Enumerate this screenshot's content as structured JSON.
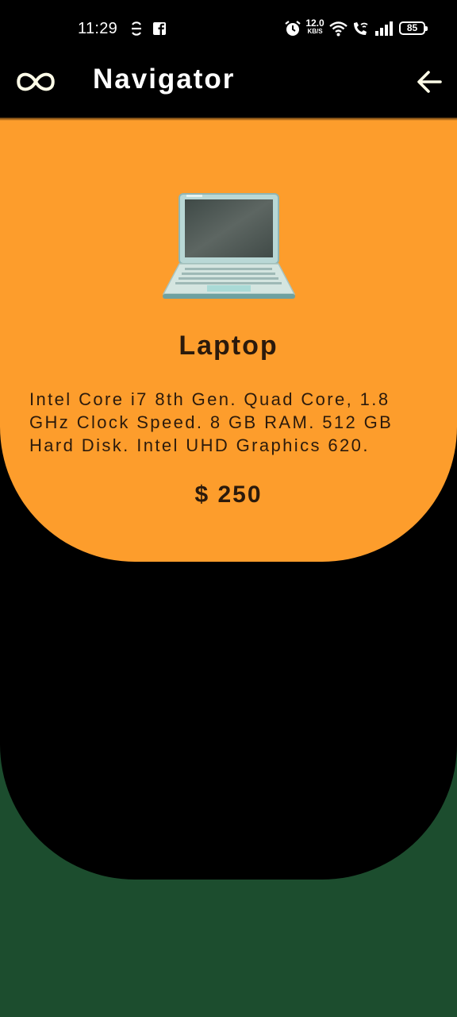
{
  "status_bar": {
    "time": "11:29",
    "network_speed": "12.0",
    "network_speed_unit": "KB/S",
    "battery_level": "85",
    "icons": [
      "sync-icon",
      "facebook-icon",
      "alarm-icon",
      "wifi-icon",
      "wifi-call-icon",
      "signal-icon",
      "battery-icon"
    ]
  },
  "app_bar": {
    "logo_icon": "infinity-icon",
    "title": "Navigator",
    "back_icon": "arrow-left-icon"
  },
  "product": {
    "image_icon": "laptop-icon",
    "name": "Laptop",
    "description": "Intel Core i7 8th Gen. Quad Core, 1.8 GHz Clock Speed. 8 GB RAM. 512 GB Hard Disk. Intel UHD Graphics 620.",
    "price": "$ 250"
  },
  "colors": {
    "card": "#fd9d2c",
    "backdrop": "#000000",
    "background": "#1c4d2e",
    "text_dark": "#2b1a0c"
  }
}
